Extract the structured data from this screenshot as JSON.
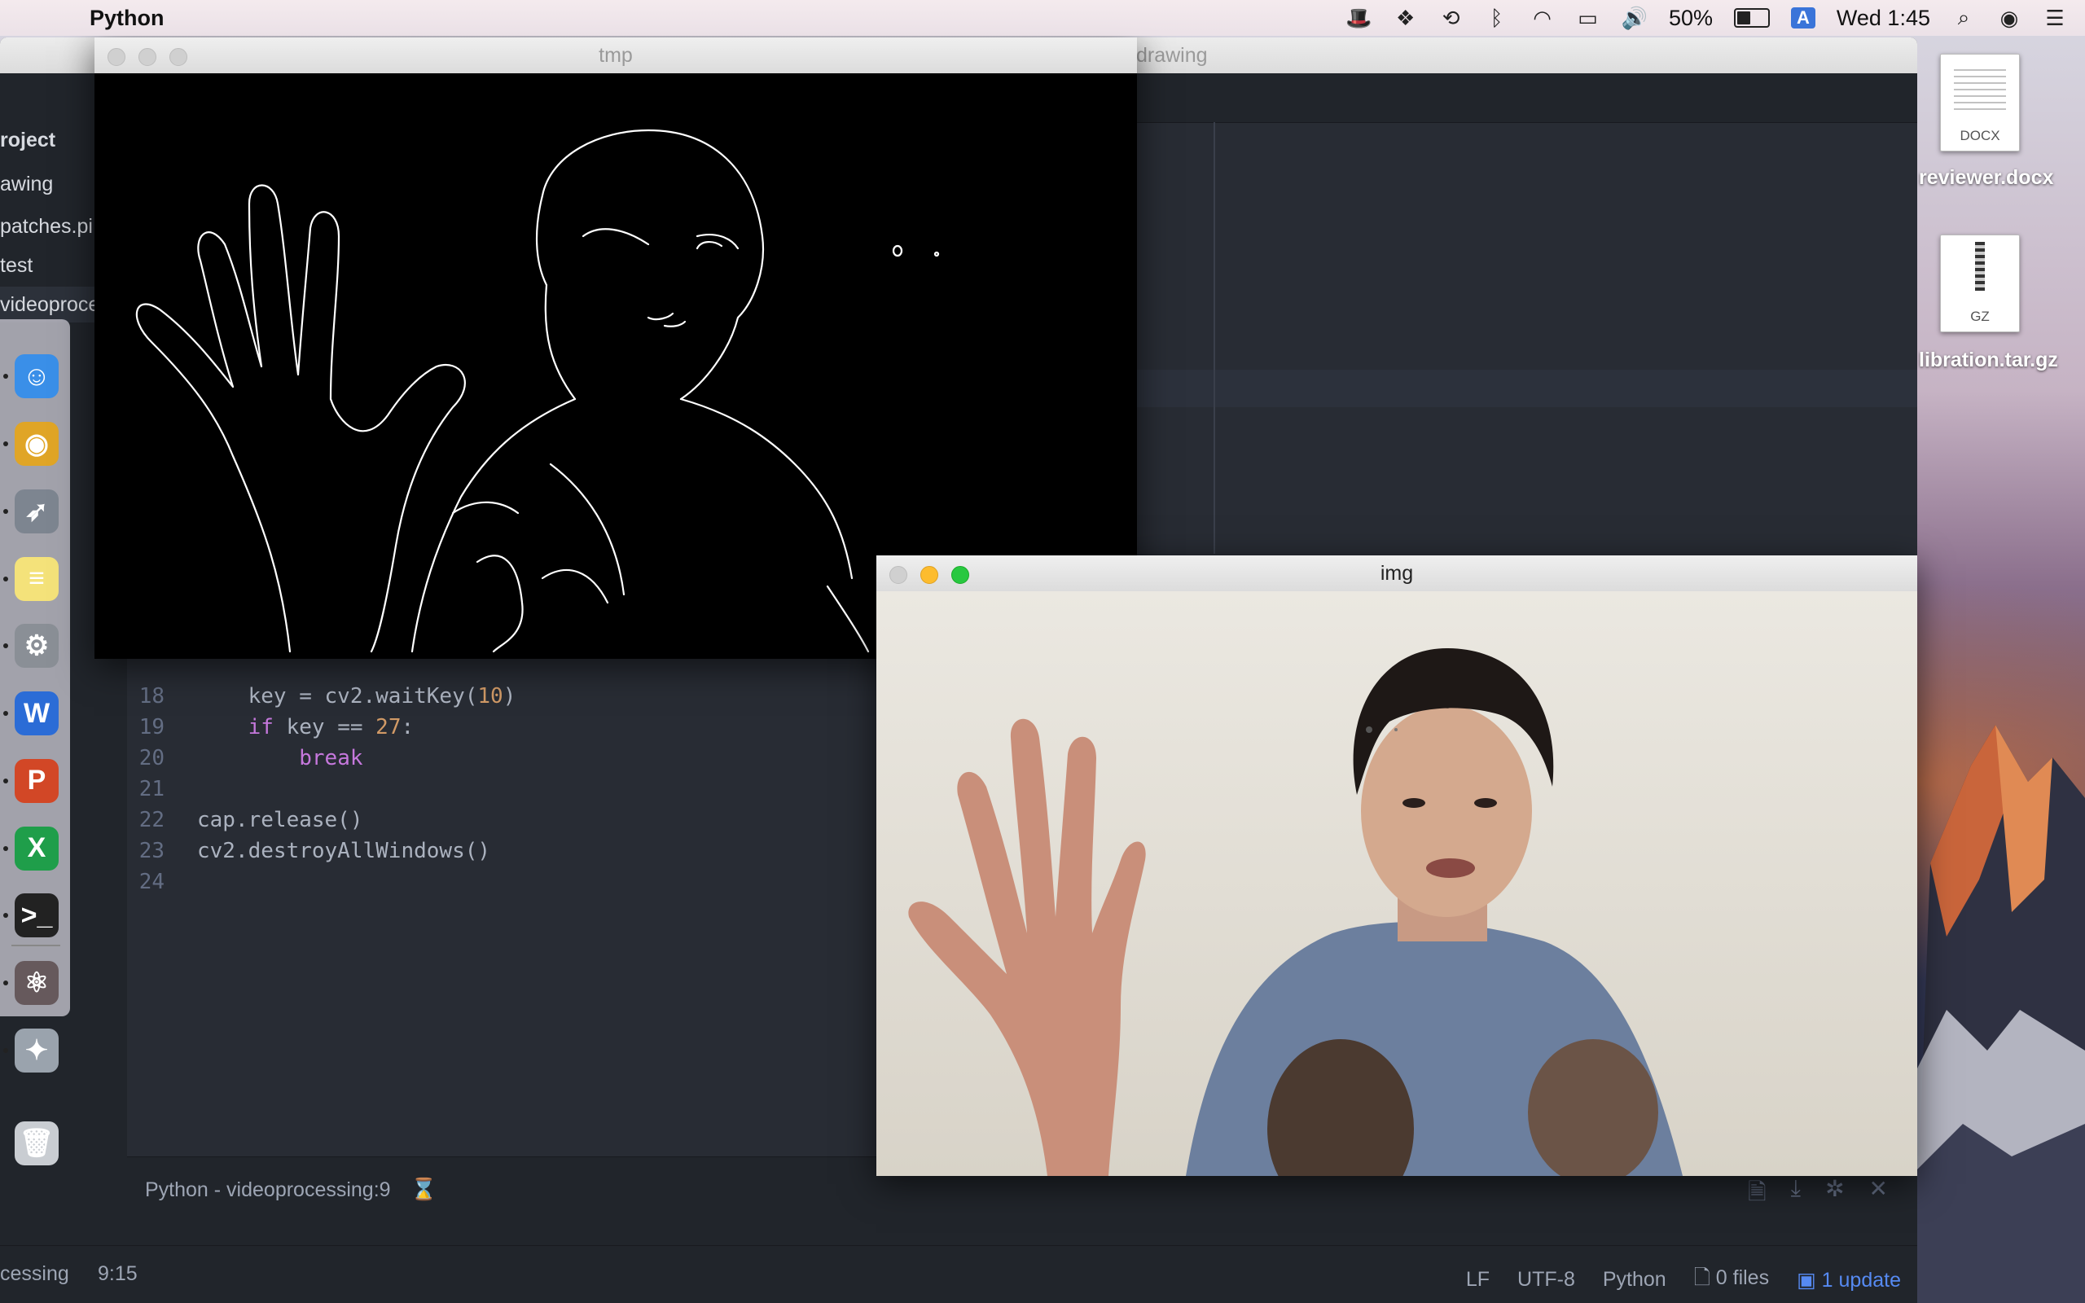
{
  "menubar": {
    "app_name": "Python",
    "battery_percent": "50%",
    "input_source": "A",
    "clock": "Wed 1:45",
    "icons": [
      "apple-icon",
      "bowler-hat-icon",
      "dropbox-icon",
      "time-machine-icon",
      "bluetooth-icon",
      "wifi-icon",
      "airplay-icon",
      "volume-icon",
      "battery-icon",
      "spotlight-icon",
      "siri-icon",
      "notification-center-icon"
    ]
  },
  "editor": {
    "window_title": "drawing",
    "tree": [
      {
        "label": "roject"
      },
      {
        "label": "awing"
      },
      {
        "label": "patches.pi"
      },
      {
        "label": "test"
      },
      {
        "label": "videoproce"
      }
    ],
    "code_lines": [
      {
        "num": "18",
        "parts": [
          {
            "t": "    key = cv2.waitKey(",
            "c": ""
          },
          {
            "t": "10",
            "c": "nm"
          },
          {
            "t": ")",
            "c": ""
          }
        ]
      },
      {
        "num": "19",
        "parts": [
          {
            "t": "    ",
            "c": ""
          },
          {
            "t": "if",
            "c": "kw"
          },
          {
            "t": " key == ",
            "c": ""
          },
          {
            "t": "27",
            "c": "nm"
          },
          {
            "t": ":",
            "c": ""
          }
        ]
      },
      {
        "num": "20",
        "parts": [
          {
            "t": "        ",
            "c": ""
          },
          {
            "t": "break",
            "c": "kw"
          }
        ]
      },
      {
        "num": "21",
        "parts": []
      },
      {
        "num": "22",
        "parts": [
          {
            "t": "cap.release()",
            "c": ""
          }
        ]
      },
      {
        "num": "23",
        "parts": [
          {
            "t": "cv2.destroyAllWindows()",
            "c": ""
          }
        ]
      },
      {
        "num": "24",
        "parts": []
      }
    ],
    "panel_label": "Python - videoprocessing:9",
    "status": {
      "file": "cessing",
      "cursor": "9:15",
      "line_ending": "LF",
      "encoding": "UTF-8",
      "grammar": "Python",
      "files": "0 files",
      "update": "1 update"
    }
  },
  "windows": {
    "tmp_title": "tmp",
    "img_title": "img"
  },
  "desktop": {
    "file1": {
      "ext": "DOCX",
      "label": "reviewer.docx"
    },
    "file2": {
      "ext": "GZ",
      "label": "libration.tar.gz"
    }
  },
  "dock": [
    {
      "name": "finder",
      "color": "#3a8fe8",
      "glyph": "☺"
    },
    {
      "name": "chrome",
      "color": "#e0a526",
      "glyph": "◉"
    },
    {
      "name": "launchpad",
      "color": "#7d8590",
      "glyph": "➶"
    },
    {
      "name": "notes",
      "color": "#f4e27a",
      "glyph": "≡"
    },
    {
      "name": "system-preferences",
      "color": "#8a8f96",
      "glyph": "⚙"
    },
    {
      "name": "word",
      "color": "#2b6cd6",
      "glyph": "W"
    },
    {
      "name": "powerpoint",
      "color": "#d24726",
      "glyph": "P"
    },
    {
      "name": "excel",
      "color": "#1f9e4a",
      "glyph": "X"
    },
    {
      "name": "terminal",
      "color": "#222222",
      "glyph": ">_"
    },
    {
      "name": "atom",
      "color": "#66595c",
      "glyph": "⚛"
    },
    {
      "name": "rocket",
      "color": "#9aa3ad",
      "glyph": "✦"
    },
    {
      "name": "trash",
      "color": "#c9cdd2",
      "glyph": "🗑"
    }
  ]
}
